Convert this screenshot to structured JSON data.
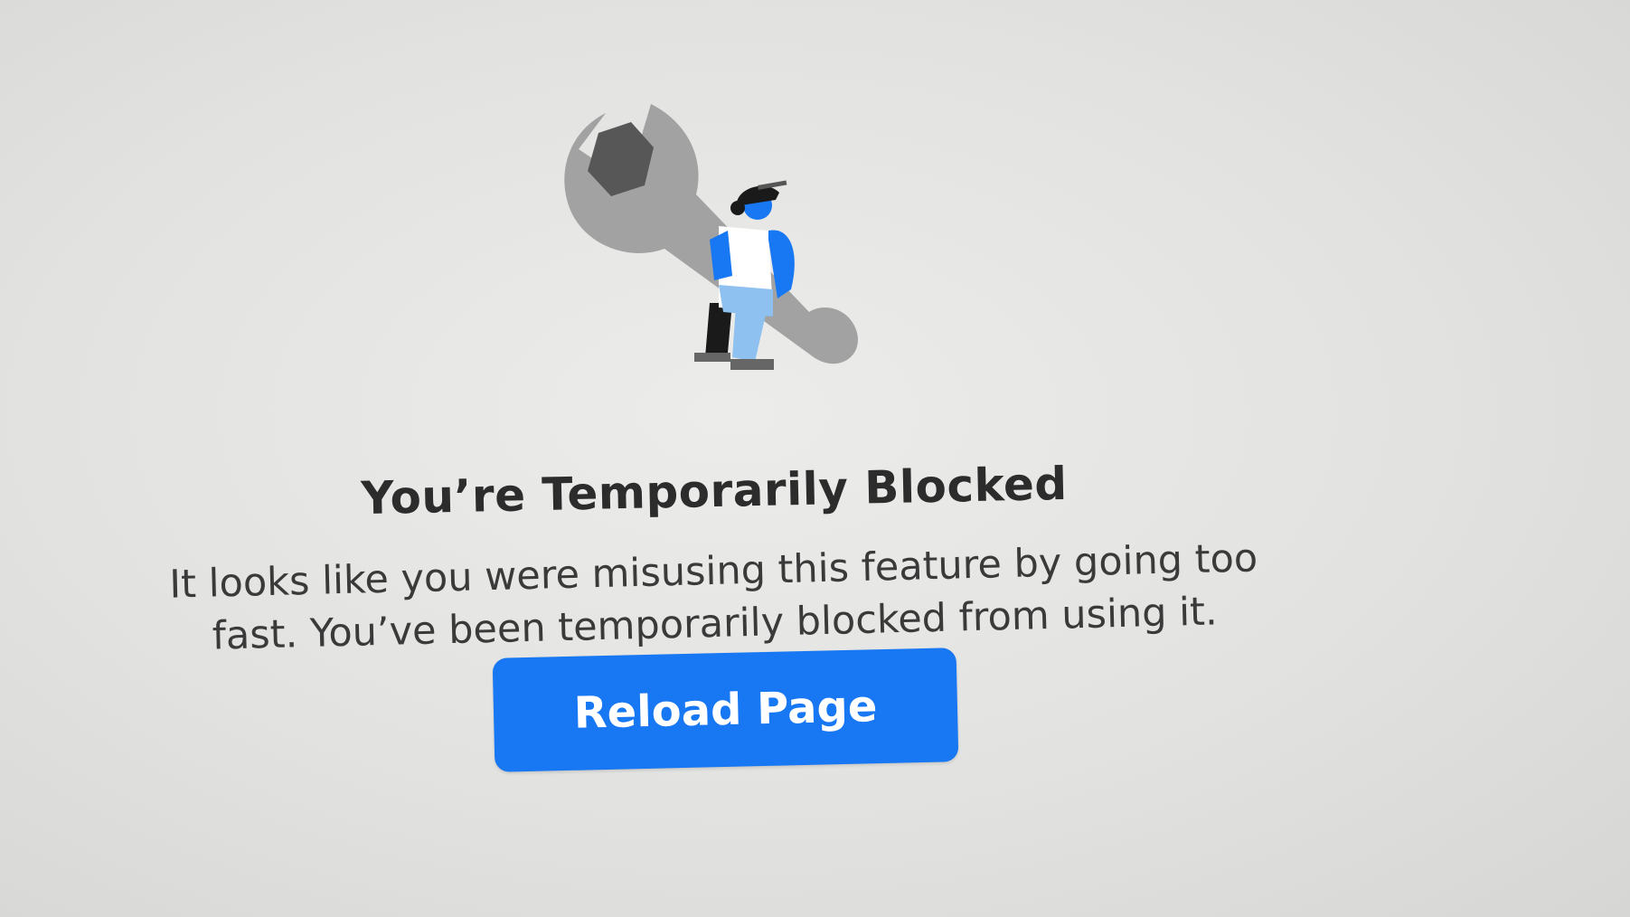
{
  "block_notice": {
    "illustration_icon": "wrench-worker-icon",
    "title": "You’re Temporarily Blocked",
    "message": "It looks like you were misusing this feature by going too fast. You’ve been temporarily blocked from using it.",
    "reload_label": "Reload Page"
  },
  "colors": {
    "accent": "#1877f2",
    "wrench": "#9e9e9e",
    "nut": "#555555",
    "worker_blue": "#1877f2",
    "worker_light_blue": "#8ec0f0",
    "text": "#2c2c2c"
  }
}
